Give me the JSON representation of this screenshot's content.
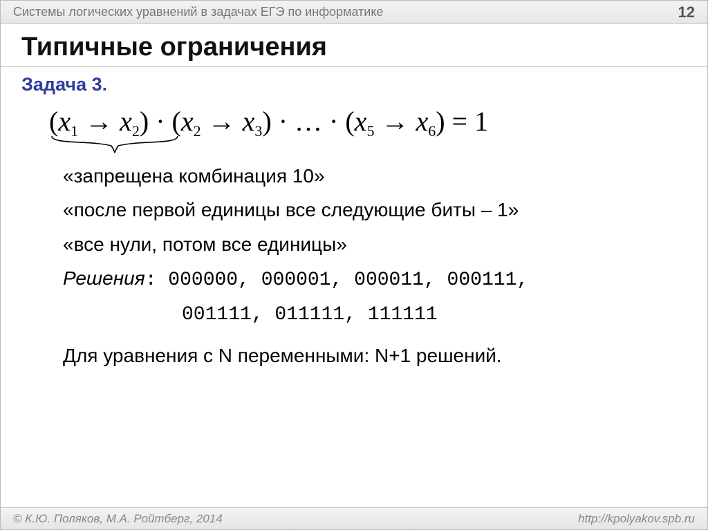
{
  "topbar": {
    "title": "Системы логических уравнений в задачах ЕГЭ по информатике",
    "page": "12"
  },
  "title": "Типичные ограничения",
  "subtitle": "Задача 3.",
  "equation": {
    "parts": [
      "(x",
      "1",
      " → x",
      "2",
      ") · (x",
      "2",
      " → x",
      "3",
      ") · … · (x",
      "5",
      " → x",
      "6",
      ") = 1"
    ]
  },
  "notes": {
    "q1": "«запрещена комбинация 10»",
    "q2": "«после первой единицы все следующие биты – 1»",
    "q3": "«все нули, потом все единицы»",
    "solutions_label": "Решения",
    "solutions_line1": ": 000000, 000001, 000011, 000111,",
    "solutions_line2": "001111, 011111, 111111",
    "general": "Для уравнения с N переменными: N+1 решений."
  },
  "footer": {
    "left": "© К.Ю. Поляков, М.А. Ройтберг, 2014",
    "right": "http://kpolyakov.spb.ru"
  }
}
